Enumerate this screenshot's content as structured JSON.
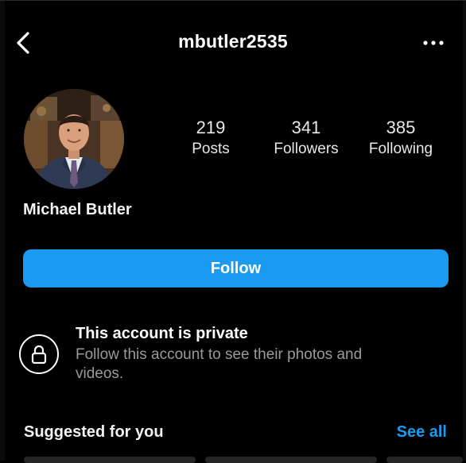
{
  "header": {
    "username": "mbutler2535",
    "back_icon": "chevron-left-icon",
    "more_icon": "more-horizontal-icon"
  },
  "profile": {
    "full_name": "Michael Butler",
    "avatar_icon": "profile-photo"
  },
  "stats": {
    "posts": {
      "value": "219",
      "label": "Posts"
    },
    "followers": {
      "value": "341",
      "label": "Followers"
    },
    "following": {
      "value": "385",
      "label": "Following"
    }
  },
  "actions": {
    "follow_label": "Follow",
    "accent_color": "#1a9bf2"
  },
  "private_notice": {
    "icon": "lock-icon",
    "title": "This account is private",
    "description": "Follow this account to see their photos and videos."
  },
  "suggested": {
    "title": "Suggested for you",
    "see_all": "See all"
  }
}
